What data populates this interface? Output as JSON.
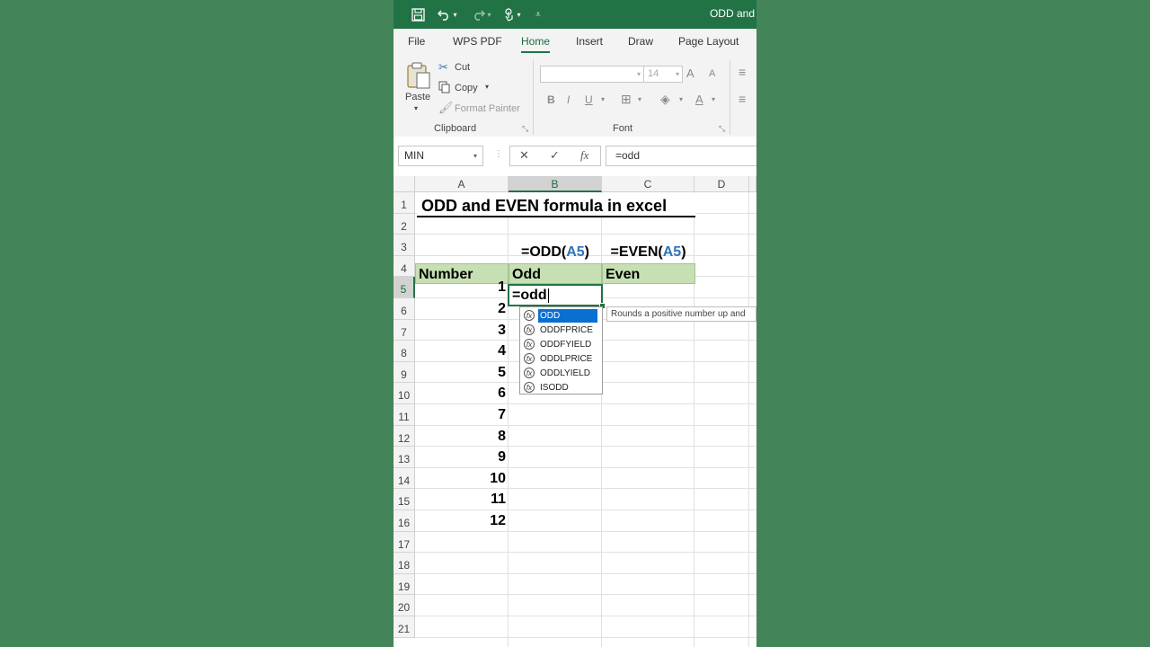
{
  "window": {
    "title": "ODD and"
  },
  "qat": {
    "save_icon": "save-icon",
    "undo_icon": "undo-icon",
    "redo_icon": "redo-icon",
    "touch_icon": "touch-mode-icon",
    "customize_icon": "customize-qat-icon"
  },
  "tabs": [
    "File",
    "WPS PDF",
    "Home",
    "Insert",
    "Draw",
    "Page Layout"
  ],
  "active_tab": "Home",
  "ribbon": {
    "clipboard": {
      "paste": "Paste",
      "cut": "Cut",
      "copy": "Copy",
      "format_painter": "Format Painter",
      "label": "Clipboard"
    },
    "font": {
      "font_name": "",
      "font_size": "14",
      "bold": "B",
      "italic": "I",
      "underline": "U",
      "grow": "A",
      "shrink": "A",
      "font_color": "A",
      "label": "Font"
    }
  },
  "formula_bar": {
    "name_box": "MIN",
    "cancel": "✕",
    "enter": "✓",
    "fx": "fx",
    "formula": "=odd"
  },
  "sheet": {
    "columns": [
      "A",
      "B",
      "C",
      "D"
    ],
    "selected_column": "B",
    "rows": [
      "1",
      "2",
      "3",
      "4",
      "5",
      "6",
      "7",
      "8",
      "9",
      "10",
      "11",
      "12",
      "13",
      "14",
      "15",
      "16",
      "17",
      "18",
      "19",
      "20",
      "21"
    ],
    "selected_row": "5",
    "title": "ODD and EVEN formula in excel",
    "formula_labels": {
      "odd_prefix": "=ODD(",
      "odd_ref": "A5",
      "odd_suffix": ")",
      "even_prefix": "=EVEN(",
      "even_ref": "A5",
      "even_suffix": ")"
    },
    "headers": {
      "number": "Number",
      "odd": "Odd",
      "even": "Even"
    },
    "active_cell_text": "=odd",
    "numbers": [
      "1",
      "2",
      "3",
      "4",
      "5",
      "6",
      "7",
      "8",
      "9",
      "10",
      "11",
      "12"
    ]
  },
  "autocomplete": {
    "items": [
      "ODD",
      "ODDFPRICE",
      "ODDFYIELD",
      "ODDLPRICE",
      "ODDLYIELD",
      "ISODD"
    ],
    "highlighted": "ODD",
    "tooltip": "Rounds a positive number up and"
  }
}
